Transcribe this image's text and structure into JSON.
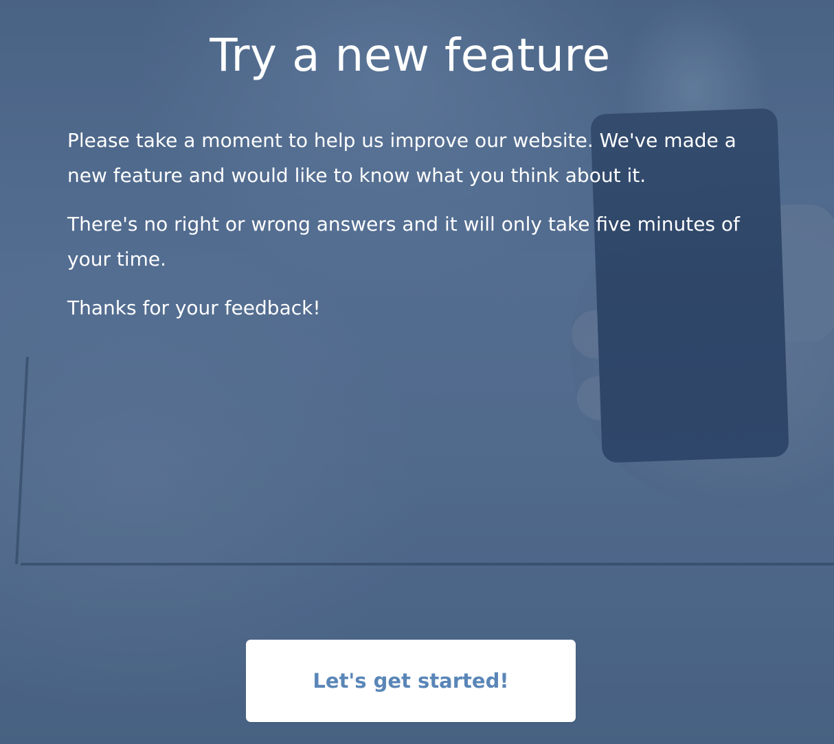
{
  "dialog": {
    "title": "Try a new feature",
    "paragraphs": [
      "Please take a moment to help us improve our website. We've made a new feature and would like to know what you think about it.",
      "There's no right or wrong answers and it will only take five minutes of your time.",
      "Thanks for your feedback!"
    ],
    "cta_label": "Let's get started!"
  },
  "colors": {
    "background_tint": "#51688a",
    "text": "#ffffff",
    "button_background": "#ffffff",
    "button_text": "#5a86b7"
  }
}
